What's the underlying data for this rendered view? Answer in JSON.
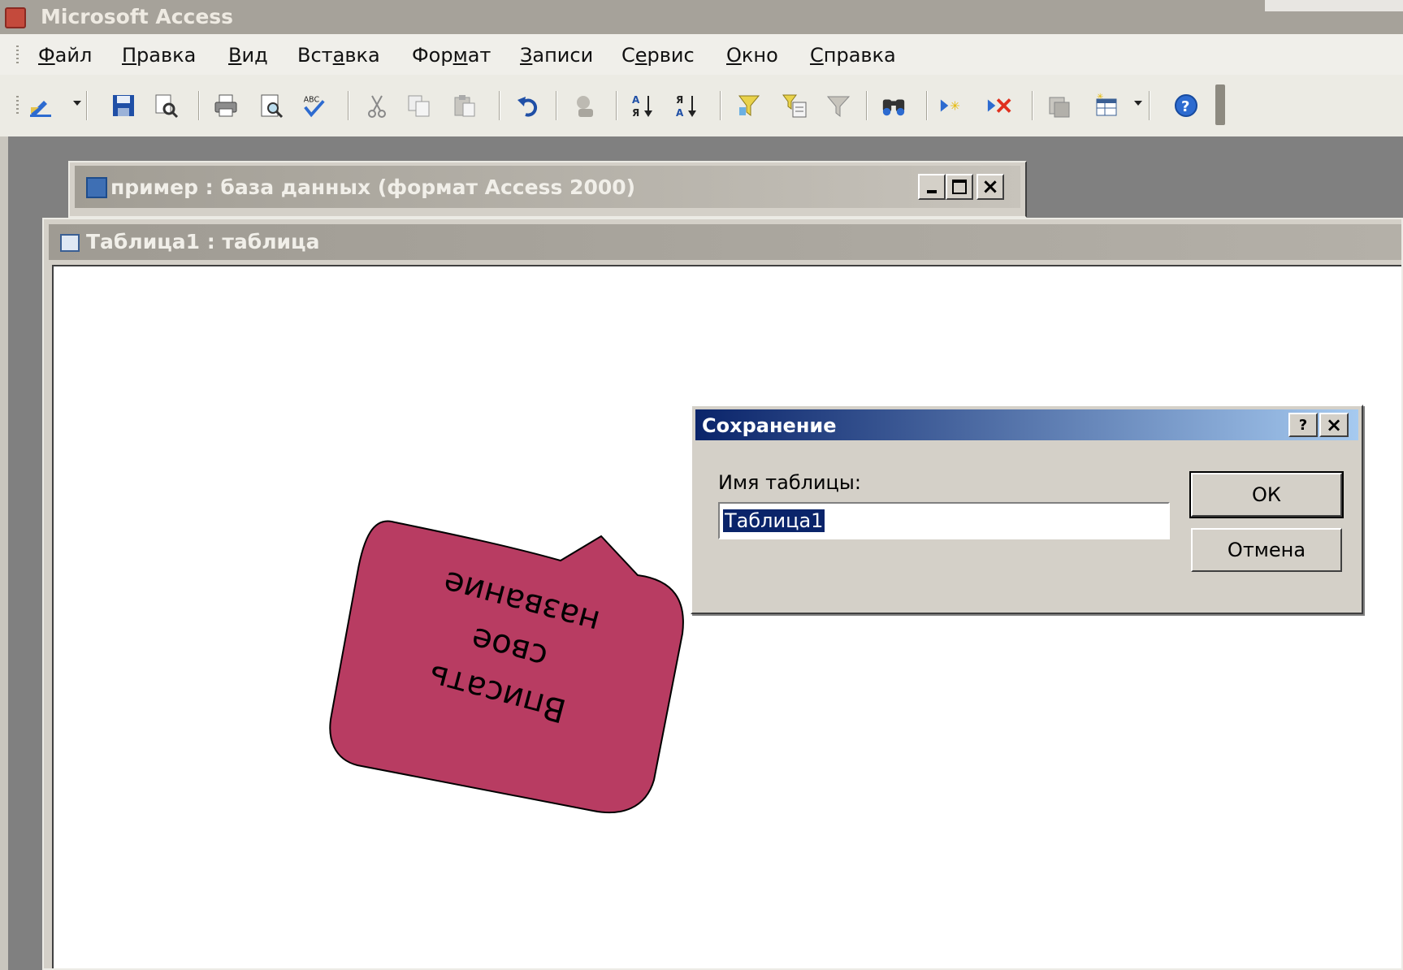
{
  "app": {
    "title": "Microsoft Access"
  },
  "menu": [
    "Файл",
    "Правка",
    "Вид",
    "Вставка",
    "Формат",
    "Записи",
    "Сервис",
    "Окно",
    "Справка"
  ],
  "toolbar": {
    "icons": [
      "view-icon",
      "save-icon",
      "search-icon",
      "print-icon",
      "print-preview-icon",
      "spelling-icon",
      "cut-icon",
      "copy-icon",
      "paste-icon",
      "undo-icon",
      "office-links-icon",
      "sort-ascending-icon",
      "sort-descending-icon",
      "filter-by-selection-icon",
      "filter-by-form-icon",
      "apply-filter-icon",
      "find-icon",
      "new-record-icon",
      "delete-record-icon",
      "database-window-icon",
      "new-object-icon",
      "help-icon"
    ]
  },
  "db_window": {
    "title": "пример : база данных (формат Access 2000)"
  },
  "table_window": {
    "title": "Таблица1 : таблица"
  },
  "dialog": {
    "title": "Сохранение",
    "field_label": "Имя таблицы:",
    "field_value": "Таблица1",
    "ok": "ОК",
    "cancel": "Отмена",
    "help_glyph": "?",
    "close_glyph": "×"
  },
  "callout": {
    "lines": [
      "Вписать",
      "свое",
      "название"
    ],
    "color": "#b83c62"
  },
  "colors": {
    "dialog_caption": "#0a246a",
    "mdi_background": "#808080"
  }
}
